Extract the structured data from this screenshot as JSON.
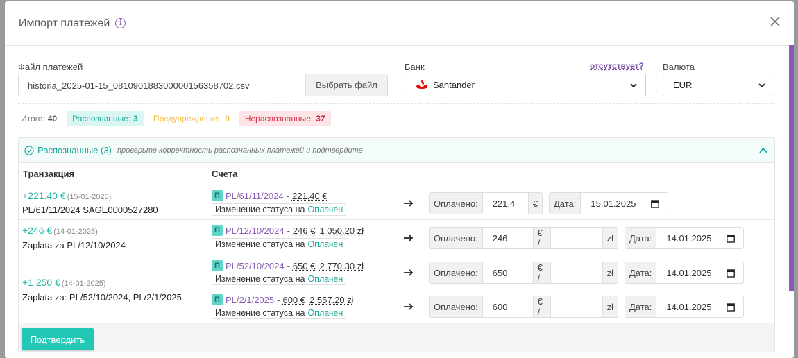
{
  "modal": {
    "title": "Импорт платежей",
    "close_icon": "close-icon"
  },
  "form": {
    "file_label": "Файл платежей",
    "file_name": "historia_2025-01-15_081090188300000156358702.csv",
    "file_button": "Выбрать файл",
    "bank_label": "Банк",
    "bank_missing_link": "отсутствует?",
    "bank_value": "Santander",
    "currency_label": "Валюта",
    "currency_value": "EUR"
  },
  "stats": {
    "total_label": "Итого:",
    "total_value": "40",
    "recognized_label": "Распознанные:",
    "recognized_value": "3",
    "warnings_label": "Предупреждения:",
    "warnings_value": "0",
    "unrecognized_label": "Нераспознанные:",
    "unrecognized_value": "37"
  },
  "panel": {
    "title": "Распознанные (3)",
    "hint": "проверьте корректность распознанных платежей и подтвердите",
    "col_transaction": "Транзакция",
    "col_invoices": "Счета",
    "paid_label": "Оплачено:",
    "date_label": "Дата:",
    "status_text": "Изменение статуса на",
    "status_value": "Оплачен",
    "badge": "П",
    "rows": [
      {
        "amount": "+221.40 €",
        "date": "(15-01-2025)",
        "ref": "PL/61/11/2024 SAGE0000527280",
        "invoices": [
          {
            "number": "PL/61/11/2024",
            "amount": "221.40 €",
            "amount2": "",
            "paid": "221.4",
            "currency": "€",
            "date": "15.01.2025"
          }
        ]
      },
      {
        "amount": "+246 €",
        "date": "(14-01-2025)",
        "ref": "Zaplata za PL/12/10/2024",
        "invoices": [
          {
            "number": "PL/12/10/2024",
            "amount": "246 €",
            "amount2": "1 050.20 zł",
            "paid": "246",
            "currency": "€ /",
            "currency2": "zł",
            "date": "14.01.2025"
          }
        ]
      },
      {
        "amount": "+1 250 €",
        "date": "(14-01-2025)",
        "ref": "Zaplata za: PL/52/10/2024, PL/2/1/2025",
        "invoices": [
          {
            "number": "PL/52/10/2024",
            "amount": "650 €",
            "amount2": "2 770.30 zł",
            "paid": "650",
            "currency": "€ /",
            "currency2": "zł",
            "date": "14.01.2025"
          },
          {
            "number": "PL/2/1/2025",
            "amount": "600 €",
            "amount2": "2 557.20 zł",
            "paid": "600",
            "currency": "€ /",
            "currency2": "zł",
            "date": "14.01.2025"
          }
        ]
      }
    ],
    "confirm_button": "Подтвердить"
  }
}
